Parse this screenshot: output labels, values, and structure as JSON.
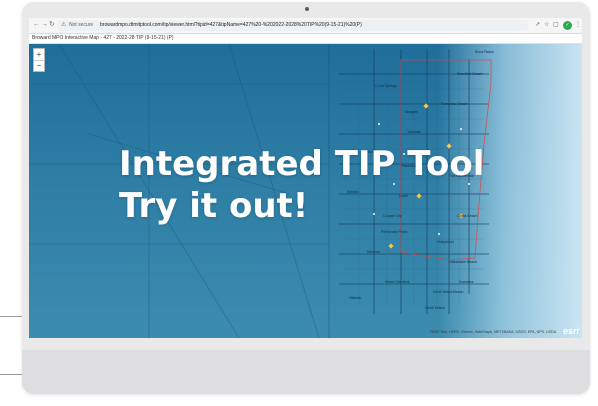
{
  "browser": {
    "security_label": "Not secure",
    "url": "browardmpo.dtmitptool.com/tip/viewer.html?tipid=427&tipName=427%20-%202022-2028%20TIP%20(9-15-21)%20(P)",
    "icons": [
      "back-arrow-icon",
      "forward-arrow-icon",
      "reload-icon",
      "warning-icon",
      "share-icon",
      "star-icon",
      "extension-icon",
      "menu-dots-icon"
    ]
  },
  "app": {
    "title": "Broward MPO Interactive Map - 427 - 2022-28 TIP (9-15-21) (P)"
  },
  "map": {
    "zoom_in": "+",
    "zoom_out": "−",
    "labels": [
      "Boca Raton",
      "Deerfield Beach",
      "Coral Springs",
      "Pompano Beach",
      "Margate",
      "Tamarac",
      "Sunrise",
      "Plantation",
      "Weston",
      "Davie",
      "Cooper City",
      "Pembroke Pines",
      "Miramar",
      "Hollywood",
      "Fort Lauderdale",
      "Dania Beach",
      "Hallandale Beach",
      "North Miami",
      "Miami Gardens",
      "Hialeah",
      "North Miami Beach",
      "Aventura"
    ],
    "attribution": "FDEP, Esri, HERE, Garmin, SafeGraph, METI/NASA, USGS, EPA, NPS, USDA",
    "logo": "esri",
    "colors": {
      "overlay": "#2b7aa4",
      "boundary": "#d64545",
      "road": "#1b4f72",
      "water": "#cfe8f4"
    }
  },
  "overlay": {
    "line1": "Integrated TIP Tool",
    "line2": "Try it out!"
  }
}
